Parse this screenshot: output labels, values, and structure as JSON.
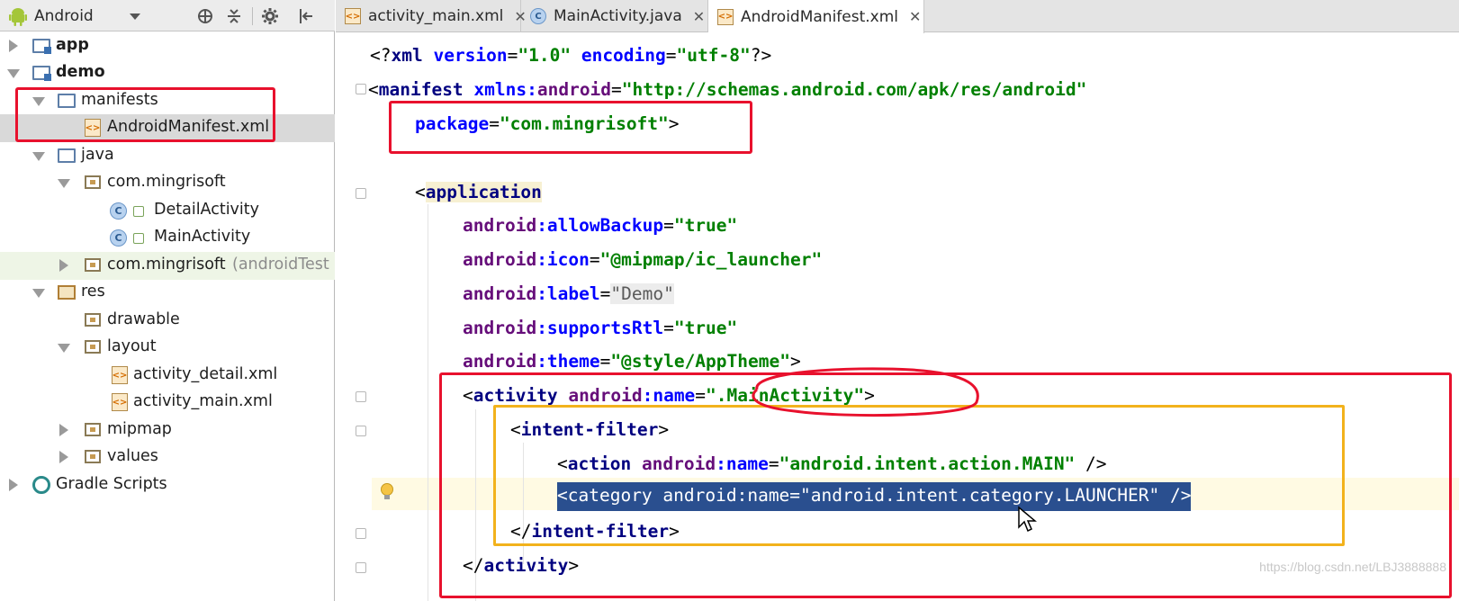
{
  "project_panel": {
    "view_selector": "Android",
    "toolbar_icons": [
      "sync-icon",
      "collapse-icon",
      "settings-icon",
      "hide-icon"
    ],
    "tree": [
      {
        "label": "app",
        "bold": true,
        "icon": "module-folder-icon",
        "expanded": false
      },
      {
        "label": "demo",
        "bold": true,
        "icon": "module-folder-icon",
        "expanded": true
      },
      {
        "label": "manifests",
        "icon": "folder-icon",
        "expanded": true
      },
      {
        "label": "AndroidManifest.xml",
        "icon": "xml-file-icon",
        "selected": true
      },
      {
        "label": "java",
        "icon": "folder-icon",
        "expanded": true
      },
      {
        "label": "com.mingrisoft",
        "icon": "package-icon",
        "expanded": true
      },
      {
        "label": "DetailActivity",
        "icon": "class-icon"
      },
      {
        "label": "MainActivity",
        "icon": "class-icon"
      },
      {
        "label": "com.mingrisoft",
        "suffix": "(androidTest",
        "icon": "package-icon",
        "expanded": false
      },
      {
        "label": "res",
        "icon": "res-folder-icon",
        "expanded": true
      },
      {
        "label": "drawable",
        "icon": "package-icon"
      },
      {
        "label": "layout",
        "icon": "package-icon",
        "expanded": true
      },
      {
        "label": "activity_detail.xml",
        "icon": "xml-file-icon"
      },
      {
        "label": "activity_main.xml",
        "icon": "xml-file-icon"
      },
      {
        "label": "mipmap",
        "icon": "package-icon",
        "expanded": false
      },
      {
        "label": "values",
        "icon": "package-icon",
        "expanded": false
      },
      {
        "label": "Gradle Scripts",
        "icon": "gradle-icon",
        "expanded": false
      }
    ]
  },
  "tabs": [
    {
      "label": "activity_main.xml",
      "icon": "xml-file-icon"
    },
    {
      "label": "MainActivity.java",
      "icon": "class-icon"
    },
    {
      "label": "AndroidManifest.xml",
      "icon": "xml-file-icon",
      "active": true
    }
  ],
  "code": {
    "l1": {
      "a": "<?",
      "b": "xml",
      "c": " version",
      "d": "=",
      "e": "\"1.0\"",
      "f": " encoding",
      "g": "=",
      "h": "\"utf-8\"",
      "i": "?>"
    },
    "l2": {
      "a": "<",
      "b": "manifest",
      "c": " xmlns:",
      "d": "android",
      "e": "=",
      "f": "\"http://schemas.android.com/apk/res/android\""
    },
    "l3": {
      "a": "package",
      "b": "=",
      "c": "\"com.mingrisoft\"",
      "d": ">"
    },
    "l4": {
      "a": "<",
      "b": "application"
    },
    "l5": {
      "a": "android",
      "b": ":allowBackup",
      "c": "=",
      "d": "\"true\""
    },
    "l6": {
      "a": "android",
      "b": ":icon",
      "c": "=",
      "d": "\"@mipmap/ic_launcher\""
    },
    "l7": {
      "a": "android",
      "b": ":label",
      "c": "=",
      "d": "\"Demo\""
    },
    "l8": {
      "a": "android",
      "b": ":supportsRtl",
      "c": "=",
      "d": "\"true\""
    },
    "l9": {
      "a": "android",
      "b": ":theme",
      "c": "=",
      "d": "\"@style/AppTheme\"",
      "e": ">"
    },
    "l10": {
      "a": "<",
      "b": "activity",
      "c": " android",
      "d": ":name",
      "e": "=",
      "f": "\".MainActivity\"",
      "g": ">"
    },
    "l11": {
      "a": "<",
      "b": "intent-filter",
      "c": ">"
    },
    "l12": {
      "a": "<",
      "b": "action",
      "c": " android",
      "d": ":name",
      "e": "=",
      "f": "\"android.intent.action.MAIN\"",
      "g": " />"
    },
    "l13": {
      "a": "<",
      "b": "category",
      "c": " android",
      "d": ":name",
      "e": "=",
      "f": "\"android.intent.category.LAUNCHER\"",
      "g": " />"
    },
    "l14": {
      "a": "</",
      "b": "intent-filter",
      "c": ">"
    },
    "l15": {
      "a": "</",
      "b": "activity",
      "c": ">"
    }
  },
  "watermark": "https://blog.csdn.net/LBJ3888888",
  "colors": {
    "annotation_red": "#e8112d",
    "annotation_yellow": "#f2b21c",
    "selection": "#2a4f8f"
  }
}
